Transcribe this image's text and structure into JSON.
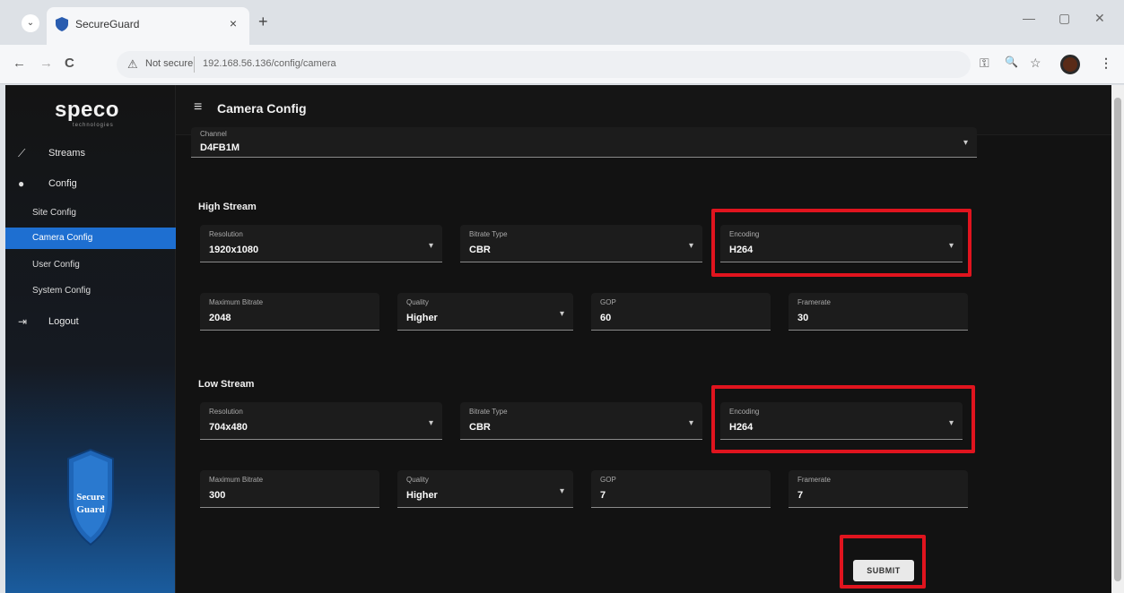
{
  "browser": {
    "tab_title": "SecureGuard",
    "tab_close": "×",
    "new_tab": "+",
    "nav_down_icon": "⌄",
    "win_min": "—",
    "win_max": "▢",
    "win_close": "✕",
    "back": "←",
    "forward": "→",
    "reload": "C",
    "not_secure": "Not secure",
    "url": "192.168.56.136/config/camera",
    "warn_icon": "⚠",
    "key_icon": "⚿",
    "zoom_icon": "🔍",
    "star_icon": "☆",
    "menu_icon": "⋮"
  },
  "sidebar": {
    "logo": "speco",
    "logo_tag": "technologies",
    "items": [
      {
        "label": "Streams",
        "icon": "⟋"
      },
      {
        "label": "Config",
        "icon": "●"
      }
    ],
    "sub_items": [
      {
        "label": "Site Config"
      },
      {
        "label": "Camera Config"
      },
      {
        "label": "User Config"
      },
      {
        "label": "System Config"
      }
    ],
    "logout": {
      "label": "Logout",
      "icon": "⇥"
    },
    "badge_line1": "Secure",
    "badge_line2": "Guard"
  },
  "header": {
    "menu_icon": "≡",
    "title": "Camera Config"
  },
  "channel": {
    "label": "Channel",
    "value": "D4FB1M",
    "caret": "▾"
  },
  "high_stream": {
    "title": "High Stream",
    "resolution": {
      "label": "Resolution",
      "value": "1920x1080",
      "caret": "▾"
    },
    "bitrate_type": {
      "label": "Bitrate Type",
      "value": "CBR",
      "caret": "▾"
    },
    "encoding": {
      "label": "Encoding",
      "value": "H264",
      "caret": "▾"
    },
    "max_bitrate": {
      "label": "Maximum Bitrate",
      "value": "2048"
    },
    "quality": {
      "label": "Quality",
      "value": "Higher",
      "caret": "▾"
    },
    "gop": {
      "label": "GOP",
      "value": "60"
    },
    "framerate": {
      "label": "Framerate",
      "value": "30"
    }
  },
  "low_stream": {
    "title": "Low Stream",
    "resolution": {
      "label": "Resolution",
      "value": "704x480",
      "caret": "▾"
    },
    "bitrate_type": {
      "label": "Bitrate Type",
      "value": "CBR",
      "caret": "▾"
    },
    "encoding": {
      "label": "Encoding",
      "value": "H264",
      "caret": "▾"
    },
    "max_bitrate": {
      "label": "Maximum Bitrate",
      "value": "300"
    },
    "quality": {
      "label": "Quality",
      "value": "Higher",
      "caret": "▾"
    },
    "gop": {
      "label": "GOP",
      "value": "7"
    },
    "framerate": {
      "label": "Framerate",
      "value": "7"
    }
  },
  "submit_label": "SUBMIT",
  "colors": {
    "accent": "#1e6fd1",
    "highlight": "#e0141e"
  }
}
